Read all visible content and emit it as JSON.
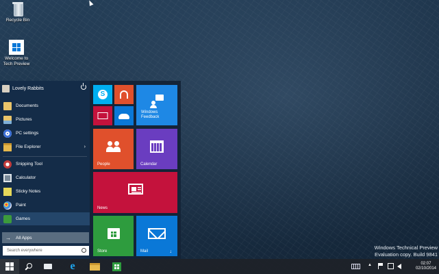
{
  "desktop": {
    "icons": [
      {
        "label": "Recycle Bin"
      },
      {
        "label": "Welcome to Tech Preview"
      }
    ],
    "watermark": {
      "line1": "Windows Technical Preview",
      "line2": "Evaluation copy. Build 9841"
    }
  },
  "start": {
    "user": {
      "name": "Lovely Rabbits"
    },
    "places": [
      {
        "label": "Documents",
        "icon": "documents-icon",
        "color": "#e9c46a"
      },
      {
        "label": "Pictures",
        "icon": "pictures-icon",
        "color": "#e9c46a"
      },
      {
        "label": "PC settings",
        "icon": "gear-icon",
        "color": "#3b6fd6"
      },
      {
        "label": "File Explorer",
        "icon": "folder-icon",
        "color": "#e5b84d",
        "submenu": "›"
      }
    ],
    "apps": [
      {
        "label": "Snipping Tool",
        "icon": "snipping-tool-icon",
        "color": "#c23b3b"
      },
      {
        "label": "Calculator",
        "icon": "calculator-icon",
        "color": "#7a8a99"
      },
      {
        "label": "Sticky Notes",
        "icon": "sticky-notes-icon",
        "color": "#e6d85a"
      },
      {
        "label": "Paint",
        "icon": "paint-icon",
        "color": "#4a90d9"
      },
      {
        "label": "Games",
        "icon": "games-icon",
        "color": "#3c9b3c"
      }
    ],
    "all_apps": {
      "label": "All Apps",
      "arrow": "→"
    },
    "search": {
      "placeholder": "Search everywhere"
    },
    "tiles": [
      {
        "id": "skype",
        "label": "",
        "color": "#00aff0",
        "icon": "skype-icon"
      },
      {
        "id": "music",
        "label": "",
        "color": "#e0502c",
        "icon": "headphones-icon"
      },
      {
        "id": "video",
        "label": "",
        "color": "#c4123c",
        "icon": "video-icon"
      },
      {
        "id": "onedrive",
        "label": "",
        "color": "#0a78d7",
        "icon": "cloud-icon"
      },
      {
        "id": "feedback",
        "label": "Windows Feedback",
        "color": "#1e88e5",
        "icon": "feedback-icon"
      },
      {
        "id": "people",
        "label": "People",
        "color": "#e0502c",
        "icon": "people-icon"
      },
      {
        "id": "calendar",
        "label": "Calendar",
        "color": "#6a3dc0",
        "icon": "calendar-icon"
      },
      {
        "id": "news",
        "label": "News",
        "color": "#c4123c",
        "icon": "news-icon"
      },
      {
        "id": "store",
        "label": "Store",
        "color": "#2e9c3e",
        "icon": "store-icon"
      },
      {
        "id": "mail",
        "label": "Mail",
        "color": "#0a78d7",
        "icon": "mail-icon",
        "badge": "↓"
      }
    ]
  },
  "taskbar": {
    "buttons": [
      {
        "name": "start-button",
        "icon": "windows-logo-icon"
      },
      {
        "name": "search-button",
        "icon": "search-icon"
      },
      {
        "name": "task-view-button",
        "icon": "task-view-icon"
      },
      {
        "name": "ie-button",
        "icon": "internet-explorer-icon",
        "glyph": "e"
      },
      {
        "name": "file-explorer-button",
        "icon": "folder-icon"
      },
      {
        "name": "store-button",
        "icon": "store-icon"
      }
    ],
    "tray": {
      "expand": "▲",
      "time": "02:07",
      "date": "02/10/2014"
    }
  }
}
